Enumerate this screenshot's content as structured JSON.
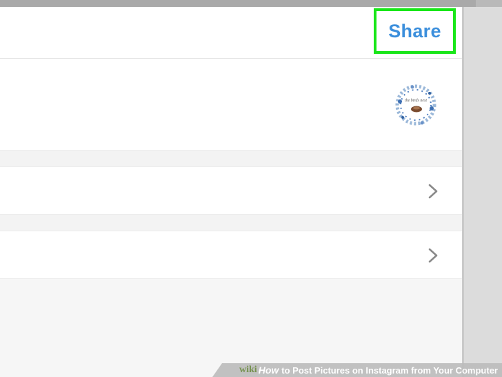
{
  "header": {
    "share_label": "Share"
  },
  "compose": {
    "thumbnail_text": "the birds nest"
  },
  "rows": [
    {
      "chevron": "chevron-right-icon"
    },
    {
      "chevron": "chevron-right-icon"
    }
  ],
  "watermark": {
    "brand": "wiki",
    "how": "How",
    "title": "to Post Pictures on Instagram from Your Computer"
  },
  "colors": {
    "share_text": "#3c8fdc",
    "highlight_border": "#19e619"
  }
}
